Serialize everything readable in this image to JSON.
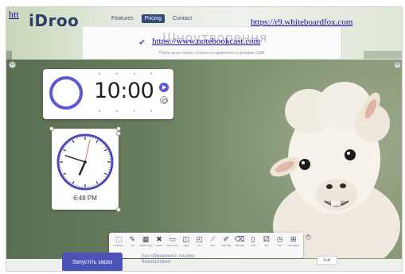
{
  "site": {
    "top_left_link": "htt",
    "logo": "iDroo",
    "nav": [
      "Features",
      "Pricing",
      "Contact"
    ],
    "active_nav": "Pricing",
    "right_link": "https://r9.whiteboardfox.com"
  },
  "banner": {
    "bg_title": "Шноутворення",
    "link": "https://www.notebookcast.com",
    "subtitle": "Плата за всі плани стягується щомісячно в доларах США"
  },
  "timer": {
    "time": "10:00"
  },
  "clock": {
    "time": "6:48 PM",
    "hour": 6,
    "minute": 48,
    "second": 2
  },
  "toolbar": {
    "tools": [
      {
        "icon": "select-icon",
        "glyph": "⬚",
        "label": "Interactive"
      },
      {
        "icon": "pen-icon",
        "glyph": "✎",
        "label": "pen"
      },
      {
        "icon": "grid-icon",
        "glyph": "▦",
        "label": "random name"
      },
      {
        "icon": "shuffle-icon",
        "glyph": "✖",
        "label": "random"
      },
      {
        "icon": "screen-icon",
        "glyph": "▭",
        "label": "draw screen"
      },
      {
        "icon": "image-icon",
        "glyph": "◫",
        "label": "image"
      },
      {
        "icon": "text-icon",
        "glyph": "◰",
        "label": "text"
      },
      {
        "icon": "line-icon",
        "glyph": "⟋",
        "label": "draw"
      },
      {
        "icon": "brush-icon",
        "glyph": "✐",
        "label": "traffic light"
      },
      {
        "icon": "trash-icon",
        "glyph": "⌫",
        "label": "traffic light"
      },
      {
        "icon": "noise-icon",
        "glyph": "▯",
        "label": "noise"
      },
      {
        "icon": "dice-icon",
        "glyph": "⚂",
        "label": "dice"
      },
      {
        "icon": "timer-icon",
        "glyph": "◷",
        "label": "timer"
      },
      {
        "icon": "widgets-icon",
        "glyph": "⊞",
        "label": "more widgets"
      }
    ],
    "close": "×"
  },
  "bottom": {
    "cta": "Запустіть зараз",
    "note_line1": "Без обмеженого пошуку",
    "note_line2": "безкоштовно",
    "box": "Full"
  },
  "corner": {
    "left": "⊖",
    "right": "⊖"
  },
  "colors": {
    "accent": "#5b59d6",
    "board": "#6a7f60",
    "cta": "#4b53b8"
  }
}
